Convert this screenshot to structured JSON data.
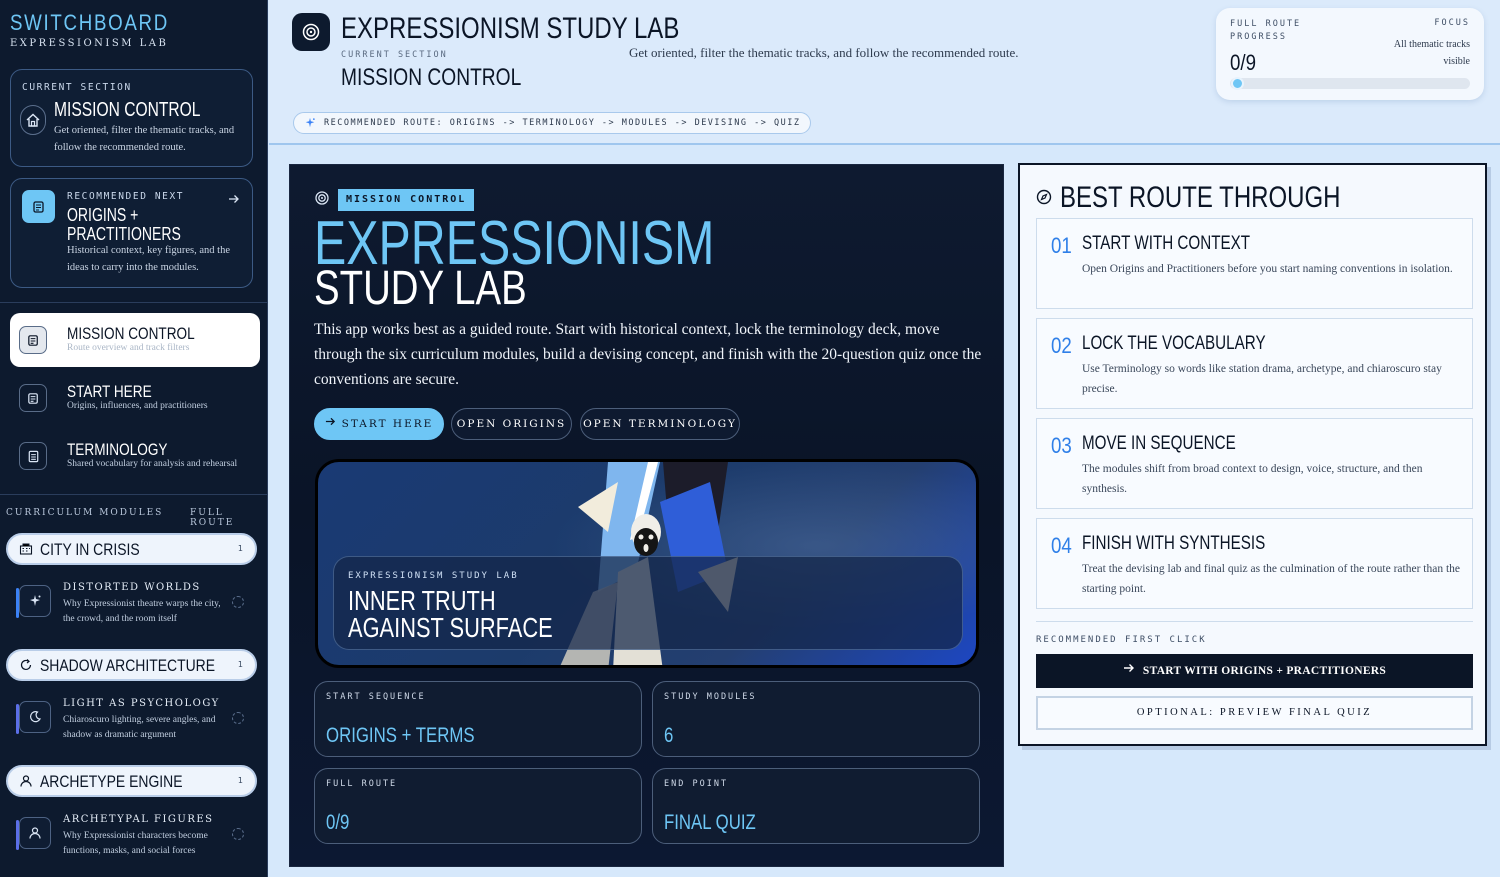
{
  "sidebar": {
    "brand_title": "SWITCHBOARD",
    "brand_sub": "EXPRESSIONISM LAB",
    "current_card": {
      "eyebrow": "CURRENT SECTION",
      "title": "MISSION CONTROL",
      "desc": "Get oriented, filter the thematic tracks, and follow the recommended route.",
      "icon": "home-icon"
    },
    "next_card": {
      "eyebrow": "RECOMMENDED NEXT",
      "title": "ORIGINS + PRACTITIONERS",
      "desc": "Historical context, key figures, and the ideas to carry into the modules.",
      "icon": "scroll-icon"
    },
    "nav": [
      {
        "title": "MISSION CONTROL",
        "sub": "Route overview and track filters",
        "icon": "scroll-icon",
        "active": true
      },
      {
        "title": "START HERE",
        "sub": "Origins, influences, and practitioners",
        "icon": "scroll-icon",
        "active": false
      },
      {
        "title": "TERMINOLOGY",
        "sub": "Shared vocabulary for analysis and rehearsal",
        "icon": "notebook-icon",
        "active": false
      }
    ],
    "modules_label": "CURRICULUM MODULES",
    "full_route_label": "FULL ROUTE",
    "groups": [
      {
        "title": "CITY IN CRISIS",
        "count": "1",
        "icon": "city-icon",
        "item": {
          "title": "DISTORTED WORLDS",
          "desc": "Why Expressionist theatre warps the city, the crowd, and the room itself",
          "icon": "sparkle-icon"
        }
      },
      {
        "title": "SHADOW ARCHITECTURE",
        "count": "1",
        "icon": "refresh-icon",
        "item": {
          "title": "LIGHT AS PSYCHOLOGY",
          "desc": "Chiaroscuro lighting, severe angles, and shadow as dramatic argument",
          "icon": "moon-icon"
        }
      },
      {
        "title": "ARCHETYPE ENGINE",
        "count": "1",
        "icon": "user-icon",
        "item": {
          "title": "ARCHETYPAL FIGURES",
          "desc": "Why Expressionist characters become functions, masks, and social forces",
          "icon": "user-icon"
        }
      }
    ]
  },
  "header": {
    "title": "EXPRESSIONISM STUDY LAB",
    "current_label": "CURRENT SECTION",
    "current": "MISSION CONTROL",
    "desc": "Get oriented, filter the thematic tracks, and follow the recommended route.",
    "route_pill": "RECOMMENDED ROUTE: ORIGINS -> TERMINOLOGY -> MODULES -> DEVISING -> QUIZ",
    "progress": {
      "label": "FULL ROUTE PROGRESS",
      "value": "0/9",
      "fraction": 0,
      "focus_label": "FOCUS",
      "focus_value": "All thematic tracks visible"
    }
  },
  "main": {
    "badge": "MISSION CONTROL",
    "title_line1": "EXPRESSIONISM",
    "title_line2": "STUDY LAB",
    "intro": "This app works best as a guided route. Start with historical context, lock the terminology deck, move through the six curriculum modules, build a devising concept, and finish with the 20-question quiz once the conventions are secure.",
    "buttons": {
      "start": "START HERE",
      "origins": "OPEN ORIGINS",
      "terminology": "OPEN TERMINOLOGY"
    },
    "hero": {
      "label": "EXPRESSIONISM STUDY LAB",
      "title_line1": "INNER TRUTH",
      "title_line2": "AGAINST SURFACE"
    },
    "stats": [
      {
        "label": "START SEQUENCE",
        "value": "ORIGINS + TERMS"
      },
      {
        "label": "STUDY MODULES",
        "value": "6"
      },
      {
        "label": "FULL ROUTE",
        "value": "0/9"
      },
      {
        "label": "END POINT",
        "value": "FINAL QUIZ"
      }
    ]
  },
  "route_panel": {
    "title": "BEST ROUTE THROUGH",
    "steps": [
      {
        "num": "01",
        "title": "START WITH CONTEXT",
        "desc": "Open Origins and Practitioners before you start naming conventions in isolation."
      },
      {
        "num": "02",
        "title": "LOCK THE VOCABULARY",
        "desc": "Use Terminology so words like station drama, archetype, and chiaroscuro stay precise."
      },
      {
        "num": "03",
        "title": "MOVE IN SEQUENCE",
        "desc": "The modules shift from broad context to design, voice, structure, and then synthesis."
      },
      {
        "num": "04",
        "title": "FINISH WITH SYNTHESIS",
        "desc": "Treat the devising lab and final quiz as the culmination of the route rather than the starting point."
      }
    ],
    "first_click_label": "RECOMMENDED FIRST CLICK",
    "primary_button": "START WITH ORIGINS + PRACTITIONERS",
    "secondary_button": "OPTIONAL: PREVIEW FINAL QUIZ"
  },
  "colors": {
    "accent": "#6ec6f5",
    "navy": "#0b1526",
    "sidebar": "#0d1a2e",
    "step_number": "#2f7fe8"
  }
}
